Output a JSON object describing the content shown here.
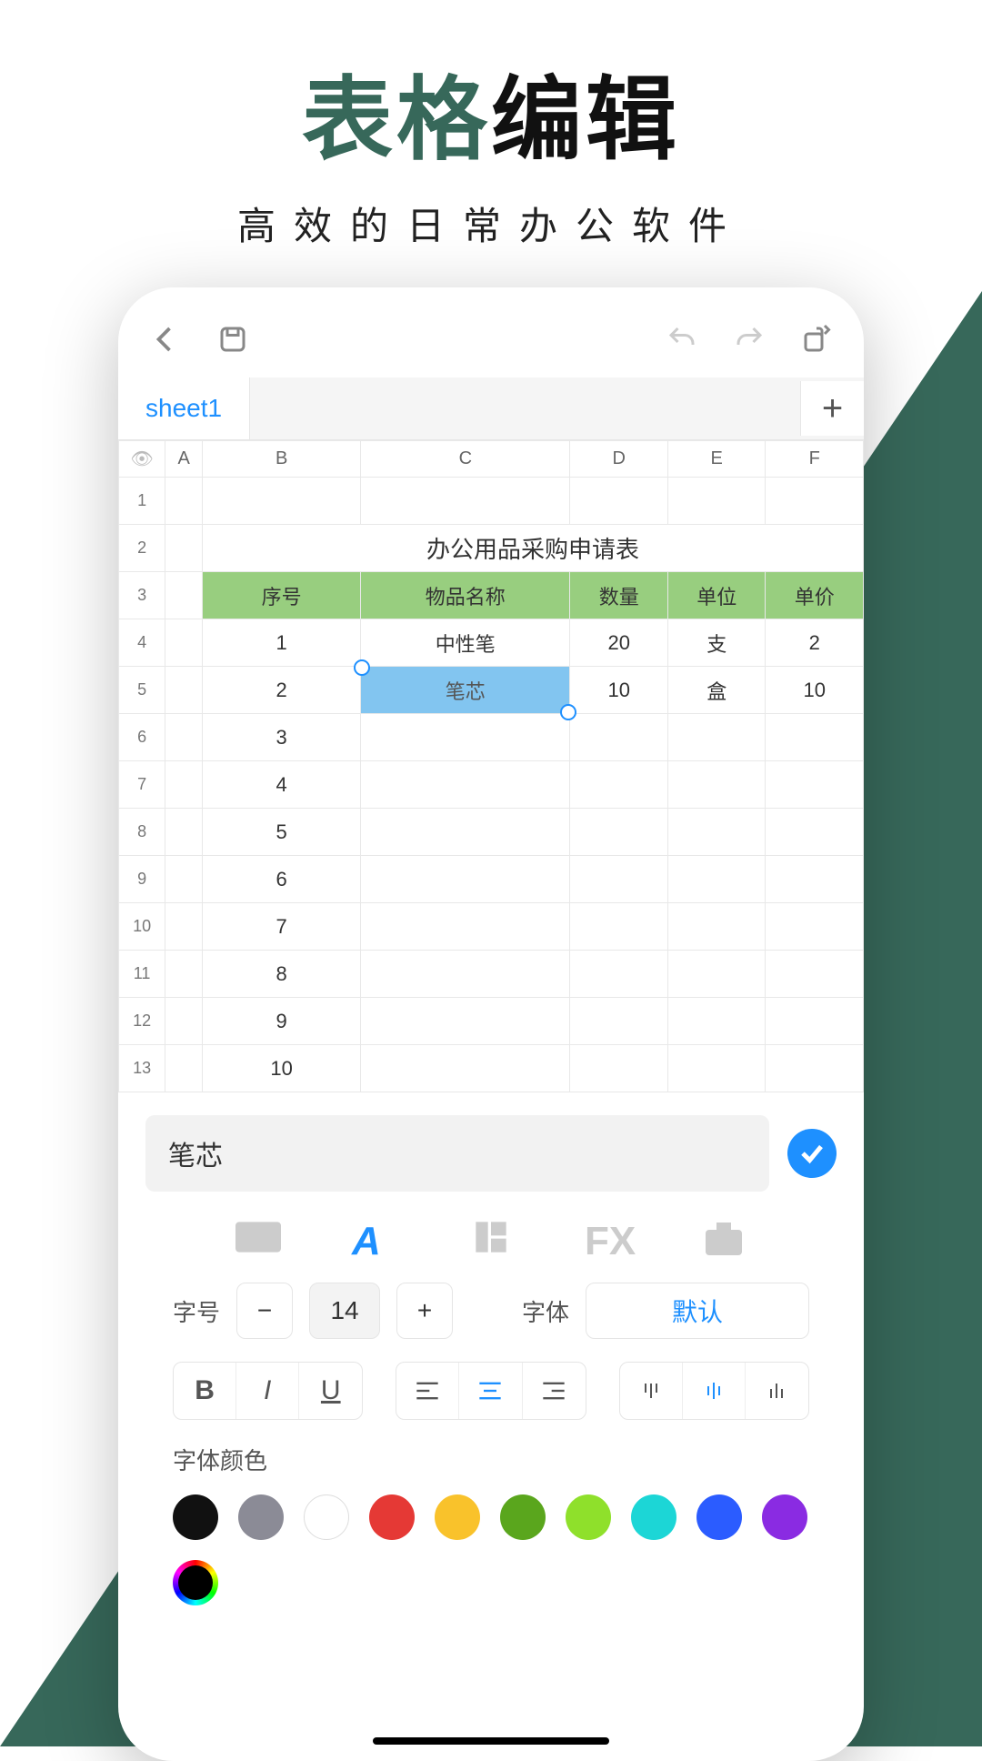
{
  "headline": {
    "part1": "表格",
    "part2": "编辑",
    "sub": "高效的日常办公软件"
  },
  "tabs": {
    "sheet": "sheet1"
  },
  "columns": [
    "A",
    "B",
    "C",
    "D",
    "E",
    "F"
  ],
  "titleRow": "办公用品采购申请表",
  "headers": {
    "b": "序号",
    "c": "物品名称",
    "d": "数量",
    "e": "单位",
    "f": "单价"
  },
  "rows": [
    {
      "b": "1",
      "c": "中性笔",
      "d": "20",
      "e": "支",
      "f": "2"
    },
    {
      "b": "2",
      "c": "笔芯",
      "d": "10",
      "e": "盒",
      "f": "10"
    },
    {
      "b": "3"
    },
    {
      "b": "4"
    },
    {
      "b": "5"
    },
    {
      "b": "6"
    },
    {
      "b": "7"
    },
    {
      "b": "8"
    },
    {
      "b": "9"
    },
    {
      "b": "10"
    }
  ],
  "editor": {
    "value": "笔芯"
  },
  "modeTabs": {
    "text": "A",
    "fx": "FX"
  },
  "format": {
    "sizeLabel": "字号",
    "sizeValue": "14",
    "fontLabel": "字体",
    "fontValue": "默认",
    "colorLabel": "字体颜色",
    "colors": [
      "#111111",
      "#8b8b96",
      "#ffffff",
      "#e53935",
      "#f9c22b",
      "#5aa61d",
      "#8fe02b",
      "#1cd6d6",
      "#2b5cff",
      "#8a2be2"
    ]
  }
}
